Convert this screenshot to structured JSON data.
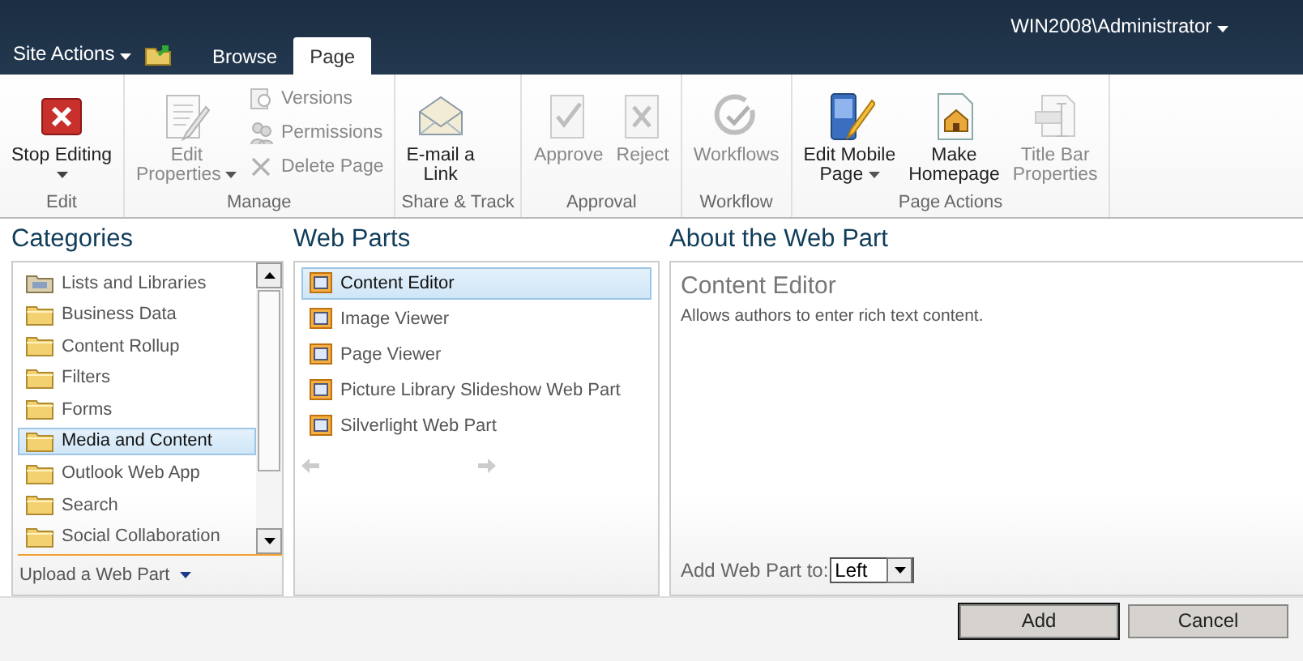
{
  "top_bar": {
    "site_actions": "Site Actions",
    "tabs": [
      {
        "label": "Browse",
        "selected": false
      },
      {
        "label": "Page",
        "selected": true
      }
    ],
    "user": "WIN2008\\Administrator"
  },
  "ribbon": {
    "groups": [
      {
        "label": "Edit",
        "buttons": [
          {
            "kind": "split",
            "lines": [
              "Stop Editing"
            ],
            "dropdown": true,
            "disabled": false
          }
        ]
      },
      {
        "label": "Manage",
        "buttons": [
          {
            "kind": "large",
            "lines": [
              "Edit",
              "Properties"
            ],
            "dropdown": true,
            "disabled": true
          },
          {
            "kind": "small",
            "lines": [
              "Versions"
            ],
            "disabled": true
          },
          {
            "kind": "small",
            "lines": [
              "Permissions"
            ],
            "disabled": true
          },
          {
            "kind": "small",
            "lines": [
              "Delete Page"
            ],
            "disabled": true
          }
        ]
      },
      {
        "label": "Share & Track",
        "buttons": [
          {
            "kind": "large",
            "lines": [
              "E-mail a",
              "Link"
            ],
            "disabled": false
          }
        ]
      },
      {
        "label": "Approval",
        "buttons": [
          {
            "kind": "large",
            "lines": [
              "Approve"
            ],
            "disabled": true
          },
          {
            "kind": "large",
            "lines": [
              "Reject"
            ],
            "disabled": true
          }
        ]
      },
      {
        "label": "Workflow",
        "buttons": [
          {
            "kind": "large",
            "lines": [
              "Workflows"
            ],
            "disabled": true
          }
        ]
      },
      {
        "label": "Page Actions",
        "buttons": [
          {
            "kind": "large",
            "lines": [
              "Edit Mobile",
              "Page"
            ],
            "dropdown": true,
            "disabled": false
          },
          {
            "kind": "large",
            "lines": [
              "Make",
              "Homepage"
            ],
            "disabled": false
          },
          {
            "kind": "large",
            "lines": [
              "Title Bar",
              "Properties"
            ],
            "disabled": true
          }
        ]
      }
    ]
  },
  "categories": {
    "title": "Categories",
    "items": [
      {
        "label": "Lists and Libraries",
        "kind": "library",
        "selected": false
      },
      {
        "label": "Business Data",
        "kind": "folder",
        "selected": false
      },
      {
        "label": "Content Rollup",
        "kind": "folder",
        "selected": false
      },
      {
        "label": "Filters",
        "kind": "folder",
        "selected": false
      },
      {
        "label": "Forms",
        "kind": "folder",
        "selected": false
      },
      {
        "label": "Media and Content",
        "kind": "folder",
        "selected": true
      },
      {
        "label": "Outlook Web App",
        "kind": "folder",
        "selected": false
      },
      {
        "label": "Search",
        "kind": "folder",
        "selected": false
      },
      {
        "label": "Social Collaboration",
        "kind": "folder",
        "selected": false
      }
    ],
    "upload": "Upload a Web Part"
  },
  "web_parts": {
    "title": "Web Parts",
    "items": [
      {
        "label": "Content Editor",
        "selected": true
      },
      {
        "label": "Image Viewer",
        "selected": false
      },
      {
        "label": "Page Viewer",
        "selected": false
      },
      {
        "label": "Picture Library Slideshow Web Part",
        "selected": false
      },
      {
        "label": "Silverlight Web Part",
        "selected": false
      }
    ]
  },
  "about": {
    "title": "About the Web Part",
    "name": "Content Editor",
    "description": "Allows authors to enter rich text content.",
    "add_to_label": "Add Web Part to:",
    "add_to_value": "Left"
  },
  "buttons": [
    {
      "label": "Add",
      "default": true
    },
    {
      "label": "Cancel",
      "default": false
    }
  ]
}
